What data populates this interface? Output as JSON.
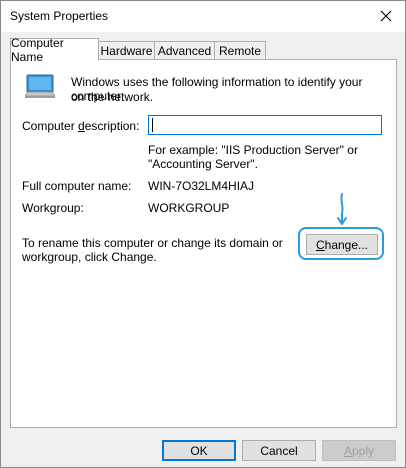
{
  "window": {
    "title": "System Properties"
  },
  "tabs": [
    {
      "label": "Computer Name",
      "active": true
    },
    {
      "label": "Hardware",
      "active": false
    },
    {
      "label": "Advanced",
      "active": false
    },
    {
      "label": "Remote",
      "active": false
    }
  ],
  "computer_name": {
    "intro_line1": "Windows uses the following information to identify your computer",
    "intro_line2": "on the network.",
    "description_label_pre": "Computer ",
    "description_label_acc": "d",
    "description_label_post": "escription:",
    "description_value": "",
    "example_line1": "For example: \"IIS Production Server\" or",
    "example_line2": "\"Accounting Server\".",
    "full_name_label": "Full computer name:",
    "full_name_value": "WIN-7O32LM4HIAJ",
    "workgroup_label": "Workgroup:",
    "workgroup_value": "WORKGROUP",
    "rename_line1": "To rename this computer or change its domain or",
    "rename_line2": "workgroup, click Change.",
    "change_label_acc": "C",
    "change_label_post": "hange..."
  },
  "footer": {
    "ok_label": "OK",
    "cancel_label": "Cancel",
    "apply_label_acc": "A",
    "apply_label_post": "pply"
  },
  "colors": {
    "accent": "#0078d7",
    "highlight": "#2b9be0"
  }
}
